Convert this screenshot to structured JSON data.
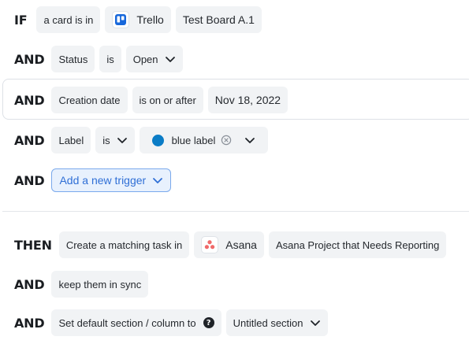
{
  "trigger": {
    "if_keyword": "IF",
    "and_keyword": "AND",
    "condition1": {
      "text": "a card is in",
      "app": "Trello",
      "board": "Test Board A.1"
    },
    "condition2": {
      "field": "Status",
      "operator": "is",
      "value": "Open"
    },
    "condition3": {
      "field": "Creation date",
      "operator": "is on or after",
      "value": "Nov 18, 2022"
    },
    "condition4": {
      "field": "Label",
      "operator": "is",
      "value": "blue label",
      "value_color": "#0a7cc6"
    },
    "add_trigger_label": "Add a new trigger"
  },
  "action": {
    "then_keyword": "THEN",
    "and_keyword": "AND",
    "step1": {
      "text": "Create a matching task in",
      "app": "Asana",
      "project": "Asana Project that Needs Reporting"
    },
    "step2": {
      "text": "keep them in sync"
    },
    "step3": {
      "text": "Set default section / column to",
      "help_icon": "question-icon",
      "value": "Untitled section"
    }
  },
  "icons": {
    "trello": "trello-logo-icon",
    "asana": "asana-logo-icon",
    "chevron": "chevron-down-icon",
    "clear": "clear-circle-icon"
  },
  "colors": {
    "accent_blue": "#2f6fd6",
    "trello_blue": "#1868db",
    "asana_coral": "#f06a6a",
    "label_blue": "#0a7cc6"
  }
}
